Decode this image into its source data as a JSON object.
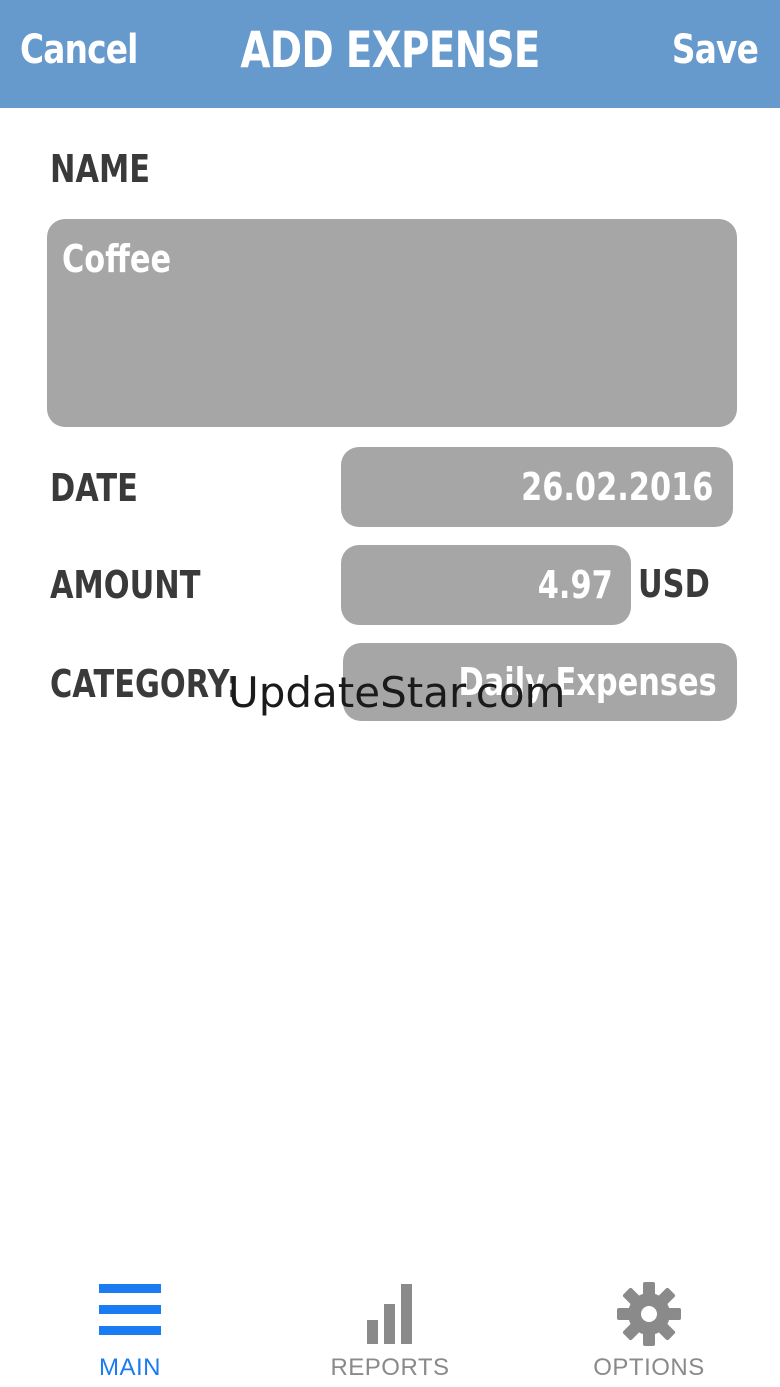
{
  "header": {
    "cancel_label": "Cancel",
    "title": "ADD EXPENSE",
    "save_label": "Save"
  },
  "form": {
    "name_label": "NAME",
    "name_value": "Coffee",
    "date_label": "DATE",
    "date_value": "26.02.2016",
    "amount_label": "AMOUNT",
    "amount_value": "4.97",
    "currency": "USD",
    "category_label": "CATEGORY:",
    "category_value": "Daily Expenses"
  },
  "watermark": "UpdateStar.com",
  "tabbar": {
    "tabs": [
      {
        "label": "MAIN",
        "icon": "hamburger-menu-icon",
        "active": true
      },
      {
        "label": "REPORTS",
        "icon": "bar-chart-icon",
        "active": false
      },
      {
        "label": "OPTIONS",
        "icon": "gear-icon",
        "active": false
      }
    ]
  },
  "colors": {
    "header_bg": "#6699CC",
    "field_bg": "#A6A6A6",
    "label_text": "#3A3A3A",
    "active_tab": "#1A7CF0",
    "inactive_tab": "#8A8A8A"
  }
}
